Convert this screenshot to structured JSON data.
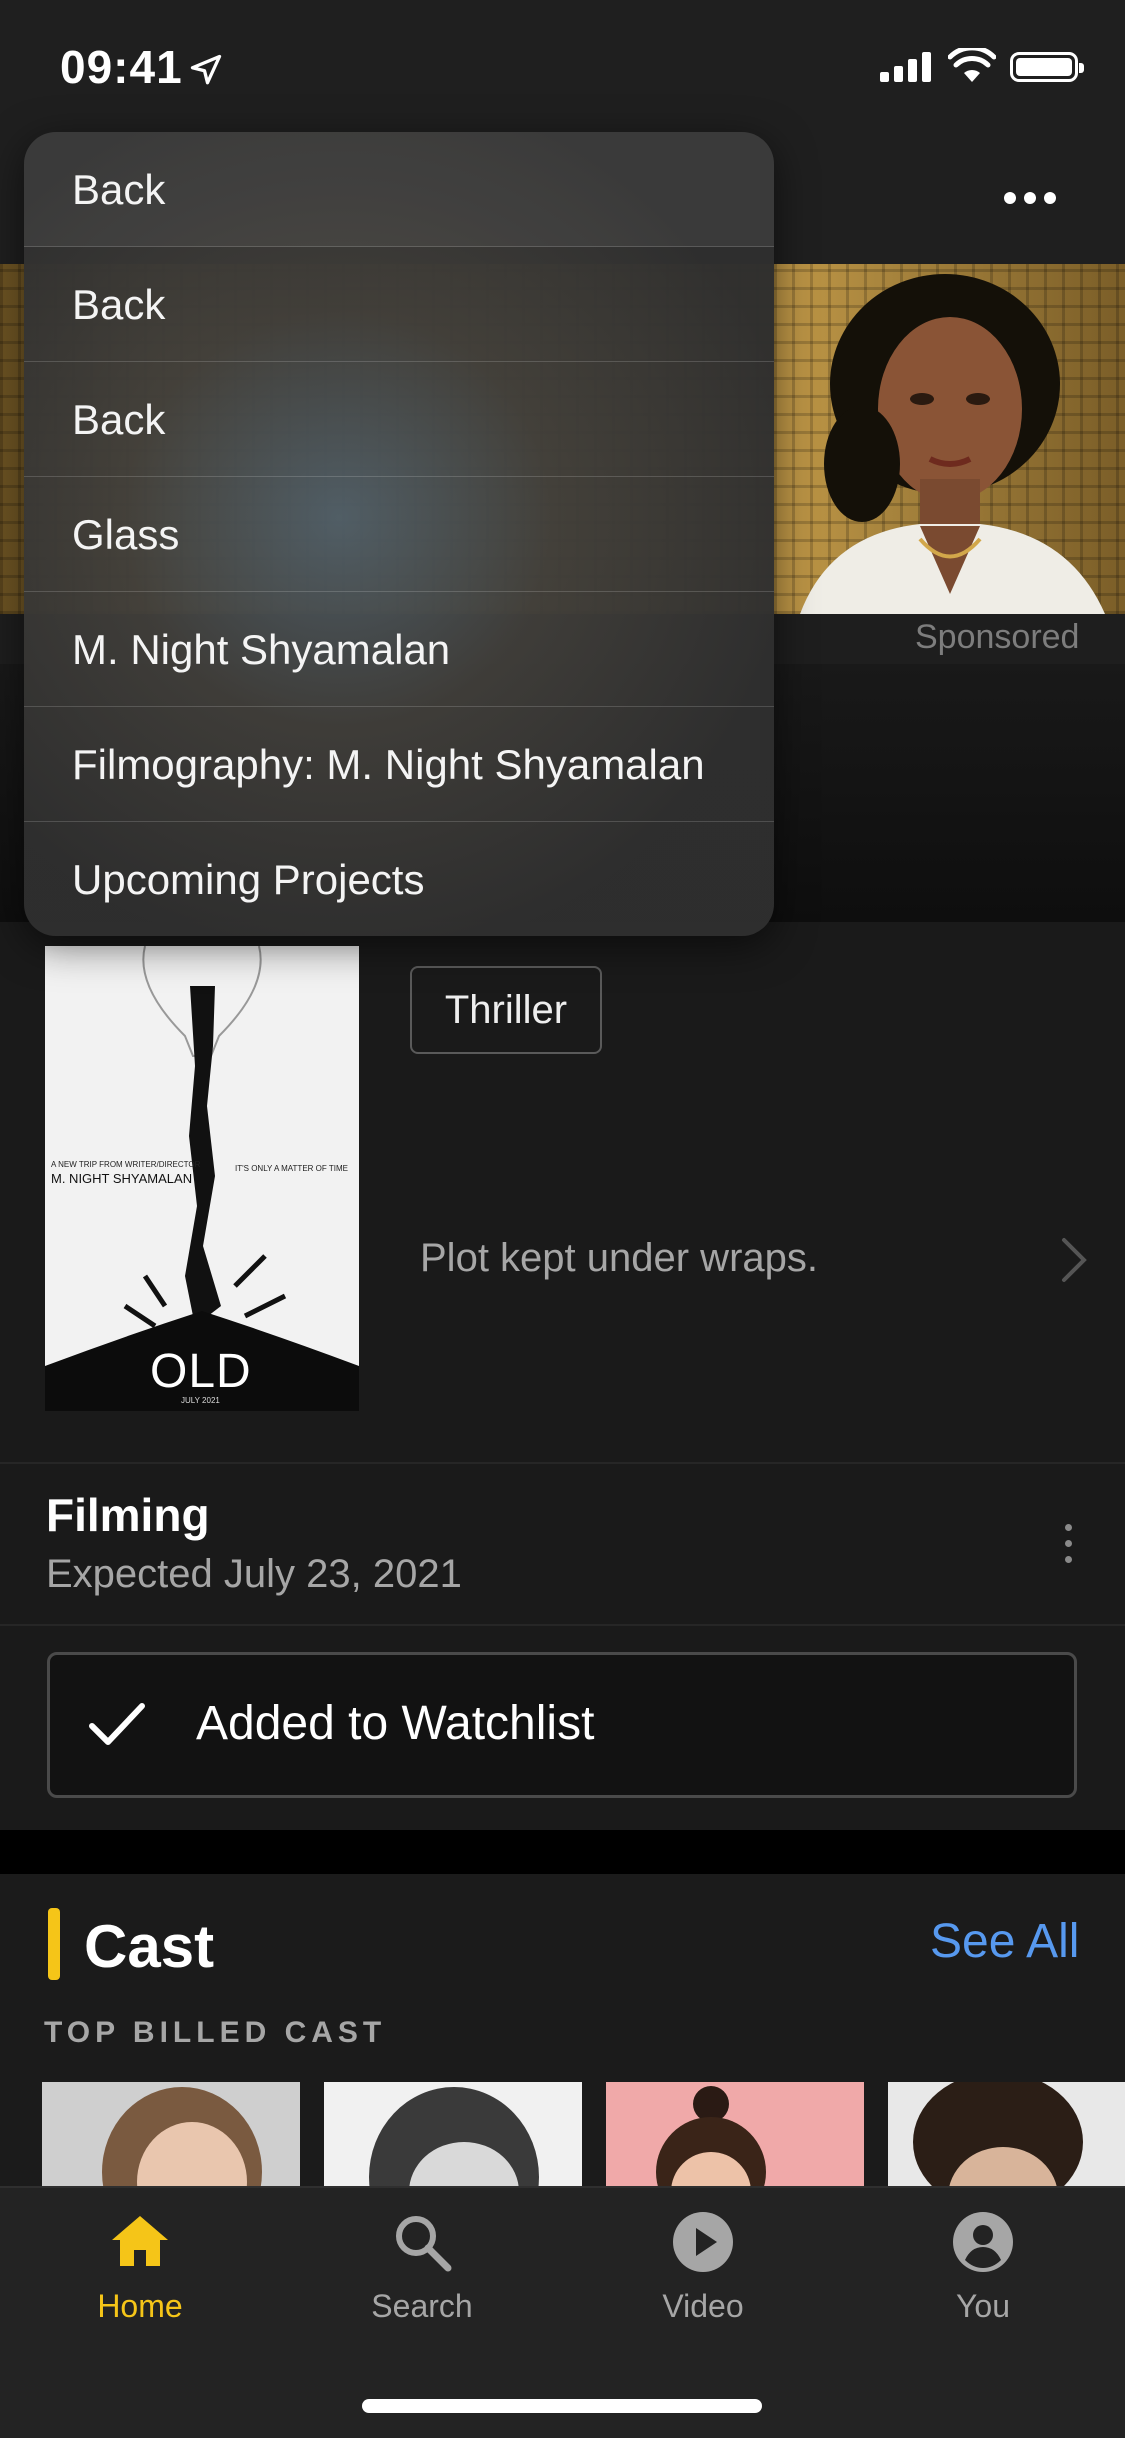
{
  "status_bar": {
    "time": "09:41"
  },
  "ad": {
    "sponsored": "Sponsored"
  },
  "menu": {
    "items": [
      "Back",
      "Back",
      "Back",
      "Glass",
      "M. Night Shyamalan",
      "Filmography: M. Night Shyamalan",
      "Upcoming Projects"
    ]
  },
  "poster": {
    "tagline_left": "A NEW TRIP FROM WRITER/DIRECTOR",
    "director": "M. NIGHT SHYAMALAN",
    "tagline_right": "IT'S ONLY A MATTER OF TIME",
    "title": "OLD",
    "date": "JULY 2021"
  },
  "details": {
    "genre": "Thriller",
    "plot": "Plot kept under wraps.",
    "status_title": "Filming",
    "status_sub": "Expected July 23, 2021",
    "watchlist_label": "Added to Watchlist"
  },
  "cast": {
    "title": "Cast",
    "see_all": "See All",
    "subtitle": "TOP BILLED CAST"
  },
  "tabs": [
    {
      "label": "Home",
      "icon": "home-icon",
      "active": true
    },
    {
      "label": "Search",
      "icon": "search-icon",
      "active": false
    },
    {
      "label": "Video",
      "icon": "play-icon",
      "active": false
    },
    {
      "label": "You",
      "icon": "profile-icon",
      "active": false
    }
  ],
  "colors": {
    "accent": "#f5c518",
    "link": "#5799ef"
  }
}
